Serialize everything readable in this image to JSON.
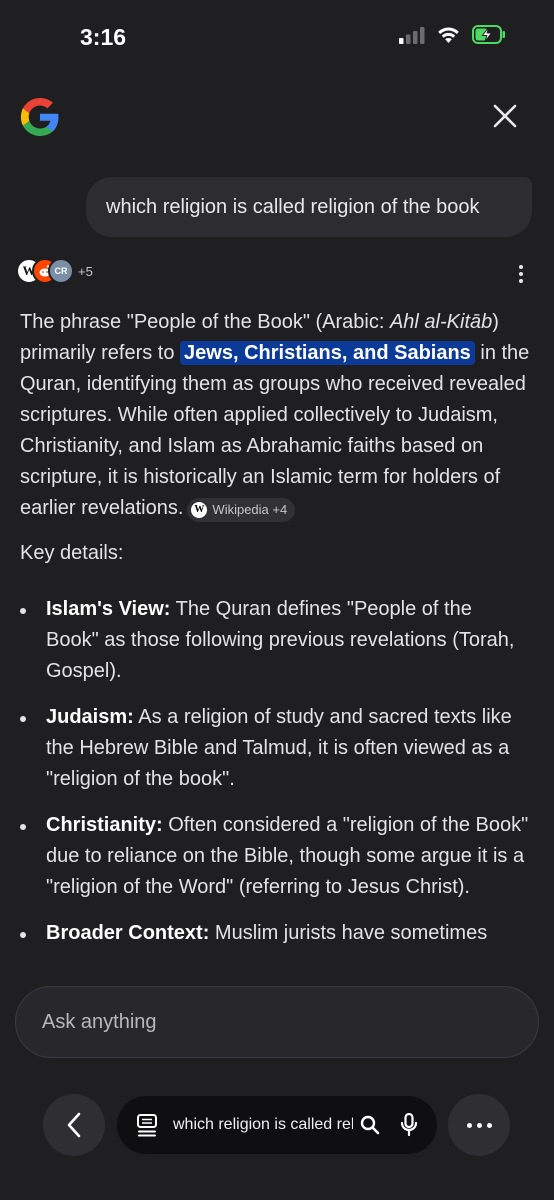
{
  "status_bar": {
    "time": "3:16"
  },
  "query": {
    "text": "which religion is called religion of the book"
  },
  "sources": {
    "favicons": [
      {
        "icon": "wikipedia-icon",
        "letter": "W"
      },
      {
        "icon": "reddit-icon",
        "letter": ""
      },
      {
        "icon": "site-icon",
        "letter": "CR"
      }
    ],
    "more_count": "+5"
  },
  "answer": {
    "p1_a": "The phrase \"People of the Book\" (Arabic: ",
    "p1_arabic": "Ahl al-Kitāb",
    "p1_b": ") primarily refers to ",
    "p1_highlight": "Jews, Christians, and Sabians",
    "p1_c": " in the Quran, identifying them as groups who received revealed scriptures. While often applied collectively to Judaism, Christianity, and Islam as Abrahamic faiths based on scripture, it is historically an Islamic term for holders of earlier revelations.",
    "chip_label": "Wikipedia +4"
  },
  "key_details": "Key details:",
  "bullets": [
    {
      "title": "Islam's View:",
      "text": " The Quran defines \"People of the Book\" as those following previous revelations (Torah, Gospel)."
    },
    {
      "title": "Judaism:",
      "text": " As a religion of study and sacred texts like the Hebrew Bible and Talmud, it is often viewed as a \"religion of the book\"."
    },
    {
      "title": "Christianity:",
      "text": " Often considered a \"religion of the Book\" due to reliance on the Bible, though some argue it is a \"religion of the Word\" (referring to Jesus Christ)."
    },
    {
      "title": "Broader Context:",
      "text": " Muslim jurists have sometimes"
    }
  ],
  "ask_box": {
    "placeholder": "Ask anything"
  },
  "bottom_bar": {
    "query_text": "which religion is called religion of the book"
  },
  "colors": {
    "background": "#1f1f22",
    "highlight": "#0b3a99",
    "battery": "#4cd964"
  }
}
